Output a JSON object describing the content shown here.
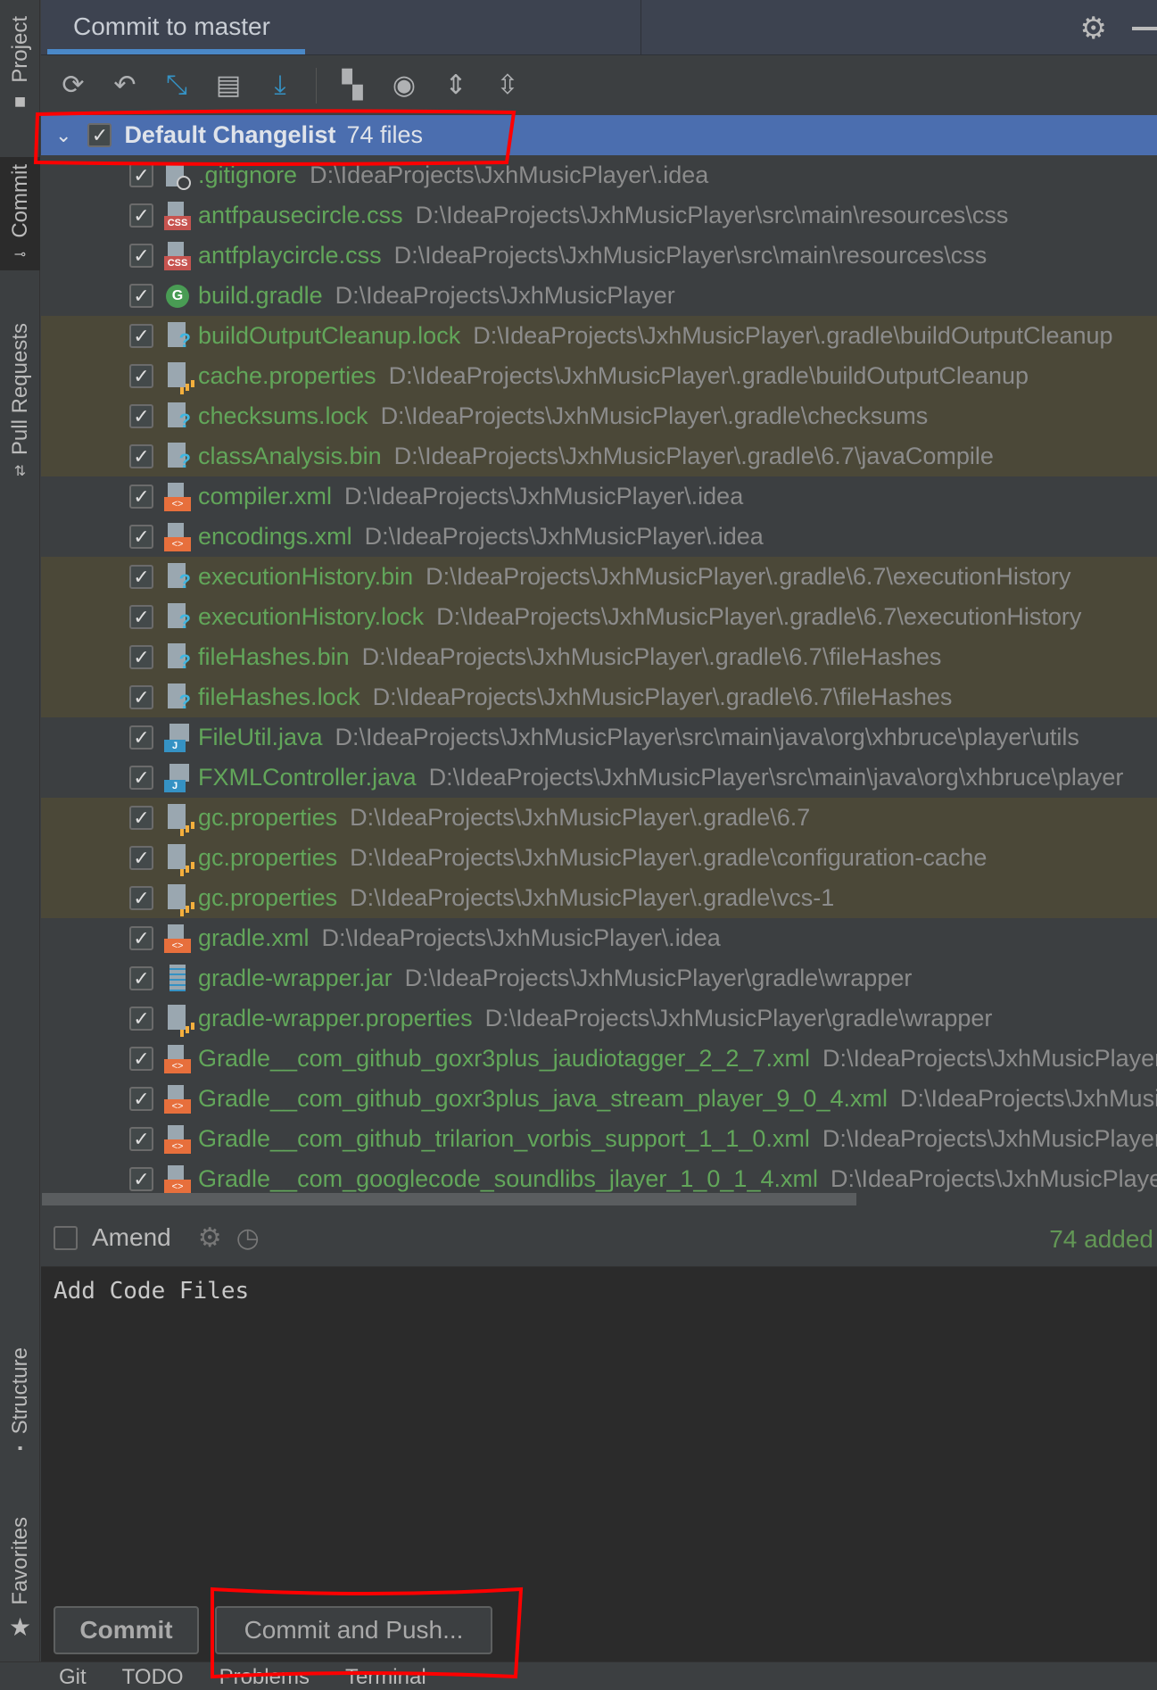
{
  "sidebar": {
    "tabs": [
      {
        "label": "Project"
      },
      {
        "label": "Commit"
      },
      {
        "label": "Pull Requests"
      },
      {
        "label": "Structure"
      },
      {
        "label": "Favorites"
      }
    ]
  },
  "header": {
    "title": "Commit to master"
  },
  "toolbar": {
    "icons": [
      "refresh-icon",
      "rollback-icon",
      "diff-icon",
      "changelist-icon",
      "update-icon",
      "group-by-icon",
      "view-options-icon",
      "expand-all-icon",
      "collapse-all-icon"
    ]
  },
  "changelist": {
    "name": "Default Changelist",
    "count": "74 files",
    "checked": true
  },
  "files": [
    {
      "name": ".gitignore",
      "path": "D:\\IdeaProjects\\JxhMusicPlayer\\.idea",
      "icon": "ignore"
    },
    {
      "name": "antfpausecircle.css",
      "path": "D:\\IdeaProjects\\JxhMusicPlayer\\src\\main\\resources\\css",
      "icon": "css"
    },
    {
      "name": "antfplaycircle.css",
      "path": "D:\\IdeaProjects\\JxhMusicPlayer\\src\\main\\resources\\css",
      "icon": "css"
    },
    {
      "name": "build.gradle",
      "path": "D:\\IdeaProjects\\JxhMusicPlayer",
      "icon": "gradle"
    },
    {
      "name": "buildOutputCleanup.lock",
      "path": "D:\\IdeaProjects\\JxhMusicPlayer\\.gradle\\buildOutputCleanup",
      "icon": "unknown",
      "unv": true
    },
    {
      "name": "cache.properties",
      "path": "D:\\IdeaProjects\\JxhMusicPlayer\\.gradle\\buildOutputCleanup",
      "icon": "props",
      "unv": true
    },
    {
      "name": "checksums.lock",
      "path": "D:\\IdeaProjects\\JxhMusicPlayer\\.gradle\\checksums",
      "icon": "unknown",
      "unv": true
    },
    {
      "name": "classAnalysis.bin",
      "path": "D:\\IdeaProjects\\JxhMusicPlayer\\.gradle\\6.7\\javaCompile",
      "icon": "unknown",
      "unv": true
    },
    {
      "name": "compiler.xml",
      "path": "D:\\IdeaProjects\\JxhMusicPlayer\\.idea",
      "icon": "xml"
    },
    {
      "name": "encodings.xml",
      "path": "D:\\IdeaProjects\\JxhMusicPlayer\\.idea",
      "icon": "xml"
    },
    {
      "name": "executionHistory.bin",
      "path": "D:\\IdeaProjects\\JxhMusicPlayer\\.gradle\\6.7\\executionHistory",
      "icon": "unknown",
      "unv": true
    },
    {
      "name": "executionHistory.lock",
      "path": "D:\\IdeaProjects\\JxhMusicPlayer\\.gradle\\6.7\\executionHistory",
      "icon": "unknown",
      "unv": true
    },
    {
      "name": "fileHashes.bin",
      "path": "D:\\IdeaProjects\\JxhMusicPlayer\\.gradle\\6.7\\fileHashes",
      "icon": "unknown",
      "unv": true
    },
    {
      "name": "fileHashes.lock",
      "path": "D:\\IdeaProjects\\JxhMusicPlayer\\.gradle\\6.7\\fileHashes",
      "icon": "unknown",
      "unv": true
    },
    {
      "name": "FileUtil.java",
      "path": "D:\\IdeaProjects\\JxhMusicPlayer\\src\\main\\java\\org\\xhbruce\\player\\utils",
      "icon": "java"
    },
    {
      "name": "FXMLController.java",
      "path": "D:\\IdeaProjects\\JxhMusicPlayer\\src\\main\\java\\org\\xhbruce\\player",
      "icon": "java"
    },
    {
      "name": "gc.properties",
      "path": "D:\\IdeaProjects\\JxhMusicPlayer\\.gradle\\6.7",
      "icon": "props",
      "unv": true
    },
    {
      "name": "gc.properties",
      "path": "D:\\IdeaProjects\\JxhMusicPlayer\\.gradle\\configuration-cache",
      "icon": "props",
      "unv": true
    },
    {
      "name": "gc.properties",
      "path": "D:\\IdeaProjects\\JxhMusicPlayer\\.gradle\\vcs-1",
      "icon": "props",
      "unv": true
    },
    {
      "name": "gradle.xml",
      "path": "D:\\IdeaProjects\\JxhMusicPlayer\\.idea",
      "icon": "xml"
    },
    {
      "name": "gradle-wrapper.jar",
      "path": "D:\\IdeaProjects\\JxhMusicPlayer\\gradle\\wrapper",
      "icon": "jar"
    },
    {
      "name": "gradle-wrapper.properties",
      "path": "D:\\IdeaProjects\\JxhMusicPlayer\\gradle\\wrapper",
      "icon": "props"
    },
    {
      "name": "Gradle__com_github_goxr3plus_jaudiotagger_2_2_7.xml",
      "path": "D:\\IdeaProjects\\JxhMusicPlayer",
      "icon": "xml"
    },
    {
      "name": "Gradle__com_github_goxr3plus_java_stream_player_9_0_4.xml",
      "path": "D:\\IdeaProjects\\JxhMusicPlayer",
      "icon": "xml"
    },
    {
      "name": "Gradle__com_github_trilarion_vorbis_support_1_1_0.xml",
      "path": "D:\\IdeaProjects\\JxhMusicPlayer",
      "icon": "xml"
    },
    {
      "name": "Gradle__com_googlecode_soundlibs_jlayer_1_0_1_4.xml",
      "path": "D:\\IdeaProjects\\JxhMusicPlayer",
      "icon": "xml"
    }
  ],
  "amend": {
    "label": "Amend",
    "checked": false,
    "summary": "74 added"
  },
  "message": {
    "text": "Add Code Files"
  },
  "buttons": {
    "commit": "Commit",
    "commit_push": "Commit and Push..."
  },
  "statusbar": {
    "items": [
      "Git",
      "TODO",
      "Problems",
      "Terminal"
    ]
  },
  "colors": {
    "accent": "#4a88c7",
    "selection": "#4b6eaf",
    "added": "#62a65a",
    "unversioned_bg": "#4b4838",
    "annotation": "#ff0000"
  }
}
